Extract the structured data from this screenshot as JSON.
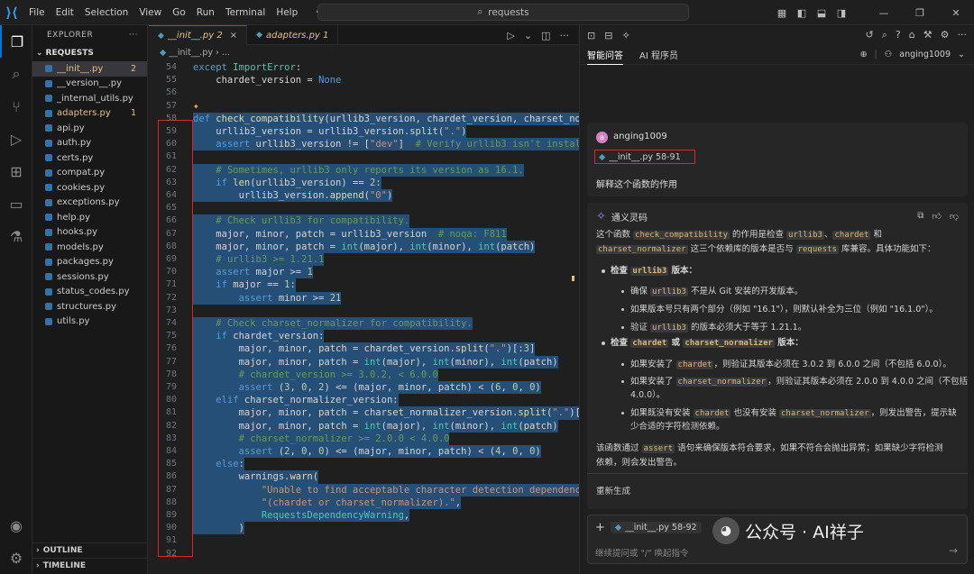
{
  "titlebar": {
    "menu": [
      "File",
      "Edit",
      "Selection",
      "View",
      "Go",
      "Run",
      "Terminal",
      "Help"
    ],
    "search": "requests"
  },
  "explorer": {
    "header": "EXPLORER",
    "folder": "REQUESTS",
    "files": [
      {
        "name": "__init__.py",
        "badge": "2",
        "modified": true,
        "selected": true
      },
      {
        "name": "__version__.py",
        "badge": "",
        "modified": false
      },
      {
        "name": "_internal_utils.py",
        "badge": "",
        "modified": false
      },
      {
        "name": "adapters.py",
        "badge": "1",
        "modified": true
      },
      {
        "name": "api.py",
        "badge": "",
        "modified": false
      },
      {
        "name": "auth.py",
        "badge": "",
        "modified": false
      },
      {
        "name": "certs.py",
        "badge": "",
        "modified": false
      },
      {
        "name": "compat.py",
        "badge": "",
        "modified": false
      },
      {
        "name": "cookies.py",
        "badge": "",
        "modified": false
      },
      {
        "name": "exceptions.py",
        "badge": "",
        "modified": false
      },
      {
        "name": "help.py",
        "badge": "",
        "modified": false
      },
      {
        "name": "hooks.py",
        "badge": "",
        "modified": false
      },
      {
        "name": "models.py",
        "badge": "",
        "modified": false
      },
      {
        "name": "packages.py",
        "badge": "",
        "modified": false
      },
      {
        "name": "sessions.py",
        "badge": "",
        "modified": false
      },
      {
        "name": "status_codes.py",
        "badge": "",
        "modified": false
      },
      {
        "name": "structures.py",
        "badge": "",
        "modified": false
      },
      {
        "name": "utils.py",
        "badge": "",
        "modified": false
      }
    ],
    "outline": "OUTLINE",
    "timeline": "TIMELINE"
  },
  "tabs": [
    {
      "label": "__init__.py 2",
      "active": true
    },
    {
      "label": "adapters.py 1",
      "active": false
    }
  ],
  "breadcrumb": [
    "__init__.py",
    "..."
  ],
  "code": [
    {
      "n": "54",
      "h": false,
      "t": [
        [
          "kw",
          "except "
        ],
        [
          "cls",
          "ImportError"
        ],
        [
          "",
          ":"
        ]
      ]
    },
    {
      "n": "55",
      "h": false,
      "t": [
        [
          "",
          "    chardet_version = "
        ],
        [
          "nn",
          "None"
        ]
      ]
    },
    {
      "n": "56",
      "h": false,
      "t": []
    },
    {
      "n": "57",
      "h": false,
      "t": []
    },
    {
      "n": "58",
      "h": true,
      "t": [
        [
          "kw",
          "def "
        ],
        [
          "fn",
          "check_compatibility"
        ],
        [
          "",
          "(urllib3_version, chardet_version, charset_normaliz"
        ]
      ]
    },
    {
      "n": "59",
      "h": true,
      "t": [
        [
          "",
          "    urllib3_version = urllib3_version."
        ],
        [
          "fn",
          "split"
        ],
        [
          "",
          "("
        ],
        [
          "str",
          "\".\""
        ],
        [
          "",
          ")"
        ]
      ]
    },
    {
      "n": "60",
      "h": true,
      "t": [
        [
          "",
          "    "
        ],
        [
          "kw",
          "assert"
        ],
        [
          "",
          " urllib3_version != ["
        ],
        [
          "str",
          "\"dev\""
        ],
        [
          "",
          "]  "
        ],
        [
          "cm",
          "# Verify urllib3 isn't installed fr"
        ]
      ]
    },
    {
      "n": "61",
      "h": true,
      "t": []
    },
    {
      "n": "62",
      "h": true,
      "t": [
        [
          "",
          "    "
        ],
        [
          "cm",
          "# Sometimes, urllib3 only reports its version as 16.1."
        ]
      ]
    },
    {
      "n": "63",
      "h": true,
      "t": [
        [
          "",
          "    "
        ],
        [
          "kw",
          "if "
        ],
        [
          "fn",
          "len"
        ],
        [
          "",
          "(urllib3_version) == "
        ],
        [
          "num",
          "2"
        ],
        [
          "",
          ":"
        ]
      ]
    },
    {
      "n": "64",
      "h": true,
      "t": [
        [
          "",
          "        urllib3_version."
        ],
        [
          "fn",
          "append"
        ],
        [
          "",
          "("
        ],
        [
          "str",
          "\"0\""
        ],
        [
          "",
          ")"
        ]
      ]
    },
    {
      "n": "65",
      "h": true,
      "t": []
    },
    {
      "n": "66",
      "h": true,
      "t": [
        [
          "",
          "    "
        ],
        [
          "cm",
          "# Check urllib3 for compatibility."
        ]
      ]
    },
    {
      "n": "67",
      "h": true,
      "t": [
        [
          "",
          "    major, minor, patch = urllib3_version  "
        ],
        [
          "cm",
          "# noqa: F811"
        ]
      ]
    },
    {
      "n": "68",
      "h": true,
      "t": [
        [
          "",
          "    major, minor, patch = "
        ],
        [
          "cls",
          "int"
        ],
        [
          "",
          "(major), "
        ],
        [
          "cls",
          "int"
        ],
        [
          "",
          "(minor), "
        ],
        [
          "cls",
          "int"
        ],
        [
          "",
          "(patch)"
        ]
      ]
    },
    {
      "n": "69",
      "h": true,
      "t": [
        [
          "",
          "    "
        ],
        [
          "cm",
          "# urllib3 >= 1.21.1"
        ]
      ]
    },
    {
      "n": "70",
      "h": true,
      "t": [
        [
          "",
          "    "
        ],
        [
          "kw",
          "assert"
        ],
        [
          "",
          " major >= "
        ],
        [
          "num",
          "1"
        ]
      ]
    },
    {
      "n": "71",
      "h": true,
      "t": [
        [
          "",
          "    "
        ],
        [
          "kw",
          "if"
        ],
        [
          "",
          " major == "
        ],
        [
          "num",
          "1"
        ],
        [
          "",
          ":"
        ]
      ]
    },
    {
      "n": "72",
      "h": true,
      "t": [
        [
          "",
          "        "
        ],
        [
          "kw",
          "assert"
        ],
        [
          "",
          " minor >= "
        ],
        [
          "num",
          "21"
        ]
      ]
    },
    {
      "n": "73",
      "h": true,
      "t": []
    },
    {
      "n": "74",
      "h": true,
      "t": [
        [
          "",
          "    "
        ],
        [
          "cm",
          "# Check charset_normalizer for compatibility."
        ]
      ]
    },
    {
      "n": "75",
      "h": true,
      "t": [
        [
          "",
          "    "
        ],
        [
          "kw",
          "if"
        ],
        [
          "",
          " chardet_version:"
        ]
      ]
    },
    {
      "n": "76",
      "h": true,
      "t": [
        [
          "",
          "        major, minor, patch = chardet_version."
        ],
        [
          "fn",
          "split"
        ],
        [
          "",
          "("
        ],
        [
          "str",
          "\".\""
        ],
        [
          "",
          ")[:"
        ],
        [
          "num",
          "3"
        ],
        [
          "",
          "]"
        ]
      ]
    },
    {
      "n": "77",
      "h": true,
      "t": [
        [
          "",
          "        major, minor, patch = "
        ],
        [
          "cls",
          "int"
        ],
        [
          "",
          "(major), "
        ],
        [
          "cls",
          "int"
        ],
        [
          "",
          "(minor), "
        ],
        [
          "cls",
          "int"
        ],
        [
          "",
          "(patch)"
        ]
      ]
    },
    {
      "n": "78",
      "h": true,
      "t": [
        [
          "",
          "        "
        ],
        [
          "cm",
          "# chardet_version >= 3.0.2, < 6.0.0"
        ]
      ]
    },
    {
      "n": "79",
      "h": true,
      "t": [
        [
          "",
          "        "
        ],
        [
          "kw",
          "assert"
        ],
        [
          "",
          " ("
        ],
        [
          "num",
          "3"
        ],
        [
          "",
          ", "
        ],
        [
          "num",
          "0"
        ],
        [
          "",
          ", "
        ],
        [
          "num",
          "2"
        ],
        [
          "",
          ") <= (major, minor, patch) < ("
        ],
        [
          "num",
          "6"
        ],
        [
          "",
          ", "
        ],
        [
          "num",
          "0"
        ],
        [
          "",
          ", "
        ],
        [
          "num",
          "0"
        ],
        [
          "",
          ")"
        ]
      ]
    },
    {
      "n": "80",
      "h": true,
      "t": [
        [
          "",
          "    "
        ],
        [
          "kw",
          "elif"
        ],
        [
          "",
          " charset_normalizer_version:"
        ]
      ]
    },
    {
      "n": "81",
      "h": true,
      "t": [
        [
          "",
          "        major, minor, patch = charset_normalizer_version."
        ],
        [
          "fn",
          "split"
        ],
        [
          "",
          "("
        ],
        [
          "str",
          "\".\""
        ],
        [
          "",
          ")[:"
        ],
        [
          "num",
          "3"
        ],
        [
          "",
          "]"
        ]
      ]
    },
    {
      "n": "82",
      "h": true,
      "t": [
        [
          "",
          "        major, minor, patch = "
        ],
        [
          "cls",
          "int"
        ],
        [
          "",
          "(major), "
        ],
        [
          "cls",
          "int"
        ],
        [
          "",
          "(minor), "
        ],
        [
          "cls",
          "int"
        ],
        [
          "",
          "(patch)"
        ]
      ]
    },
    {
      "n": "83",
      "h": true,
      "t": [
        [
          "",
          "        "
        ],
        [
          "cm",
          "# charset_normalizer >= 2.0.0 < 4.0.0"
        ]
      ]
    },
    {
      "n": "84",
      "h": true,
      "t": [
        [
          "",
          "        "
        ],
        [
          "kw",
          "assert"
        ],
        [
          "",
          " ("
        ],
        [
          "num",
          "2"
        ],
        [
          "",
          ", "
        ],
        [
          "num",
          "0"
        ],
        [
          "",
          ", "
        ],
        [
          "num",
          "0"
        ],
        [
          "",
          ") <= (major, minor, patch) < ("
        ],
        [
          "num",
          "4"
        ],
        [
          "",
          ", "
        ],
        [
          "num",
          "0"
        ],
        [
          "",
          ", "
        ],
        [
          "num",
          "0"
        ],
        [
          "",
          ")"
        ]
      ]
    },
    {
      "n": "85",
      "h": true,
      "t": [
        [
          "",
          "    "
        ],
        [
          "kw",
          "else"
        ],
        [
          "",
          ":"
        ]
      ]
    },
    {
      "n": "86",
      "h": true,
      "t": [
        [
          "",
          "        warnings."
        ],
        [
          "fn",
          "warn"
        ],
        [
          "",
          "("
        ]
      ]
    },
    {
      "n": "87",
      "h": true,
      "t": [
        [
          "",
          "            "
        ],
        [
          "str",
          "\"Unable to find acceptable character detection dependency \""
        ]
      ]
    },
    {
      "n": "88",
      "h": true,
      "t": [
        [
          "",
          "            "
        ],
        [
          "str",
          "\"(chardet or charset_normalizer).\""
        ],
        [
          "",
          ","
        ]
      ]
    },
    {
      "n": "89",
      "h": true,
      "t": [
        [
          "",
          "            "
        ],
        [
          "cls",
          "RequestsDependencyWarning"
        ],
        [
          "",
          ","
        ]
      ]
    },
    {
      "n": "90",
      "h": true,
      "t": [
        [
          "",
          "        )"
        ]
      ]
    },
    {
      "n": "91",
      "h": false,
      "t": []
    },
    {
      "n": "92",
      "h": false,
      "t": []
    }
  ],
  "panel": {
    "tab_qa": "智能问答",
    "tab_coder": "AI 程序员",
    "username": "anging1009"
  },
  "user_msg": {
    "avatar_letter": "a",
    "name": "anging1009",
    "ref": "__init__.py 58-91",
    "text": "解释这个函数的作用"
  },
  "assistant": {
    "name": "通义灵码",
    "intro": [
      "这个函数 ",
      "check_compatibility",
      " 的作用是检查 ",
      "urllib3",
      "、",
      "chardet",
      " 和 ",
      "charset_normalizer",
      " 这三个依赖库的版本是否与 ",
      "requests",
      " 库兼容。具体功能如下："
    ],
    "b1_title": [
      "检查 ",
      "urllib3",
      " 版本："
    ],
    "b1_items": [
      [
        "确保 ",
        "urllib3",
        " 不是从 Git 安装的开发版本。"
      ],
      [
        "如果版本号只有两个部分（例如 \"16.1\"），则默认补全为三位（例如 \"16.1.0\"）。"
      ],
      [
        "验证 ",
        "urllib3",
        " 的版本必须大于等于 1.21.1。"
      ]
    ],
    "b2_title": [
      "检查 ",
      "chardet",
      " 或 ",
      "charset_normalizer",
      " 版本："
    ],
    "b2_items": [
      [
        "如果安装了 ",
        "chardet",
        "，则验证其版本必须在 3.0.2 到 6.0.0 之间（不包括 6.0.0）。"
      ],
      [
        "如果安装了 ",
        "charset_normalizer",
        "，则验证其版本必须在 2.0.0 到 4.0.0 之间（不包括"
      ],
      [
        "4.0.0）。"
      ],
      [
        "如果既没有安装 ",
        "chardet",
        " 也没有安装 ",
        "charset_normalizer",
        "，则发出警告，提示缺"
      ],
      [
        "少合适的字符检测依赖。"
      ]
    ],
    "summary": [
      "该函数通过 ",
      "assert",
      " 语句来确保版本符合要求，如果不符合会抛出异常；如果缺少字符检测"
    ],
    "summary2": "依赖，则会发出警告。",
    "regen": "重新生成"
  },
  "input": {
    "ref": "__init__.py 58-92",
    "placeholder": "继续提问或 \"/\" 唤起指令"
  },
  "watermark": "公众号 · AI祥子"
}
